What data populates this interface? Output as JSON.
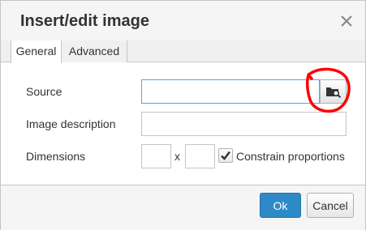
{
  "dialog": {
    "title": "Insert/edit image",
    "close_icon": "close-icon"
  },
  "tabs": [
    {
      "label": "General",
      "active": true
    },
    {
      "label": "Advanced",
      "active": false
    }
  ],
  "form": {
    "source": {
      "label": "Source",
      "value": "",
      "browse_icon": "folder-search-icon"
    },
    "description": {
      "label": "Image description",
      "value": ""
    },
    "dimensions": {
      "label": "Dimensions",
      "width": "",
      "height": "",
      "separator": "x"
    },
    "constrain": {
      "label": "Constrain proportions",
      "checked": true
    }
  },
  "footer": {
    "ok_label": "Ok",
    "cancel_label": "Cancel"
  },
  "colors": {
    "primary": "#2d8ac7",
    "focus_border": "#59a5e5",
    "annotation": "#ff0000"
  }
}
